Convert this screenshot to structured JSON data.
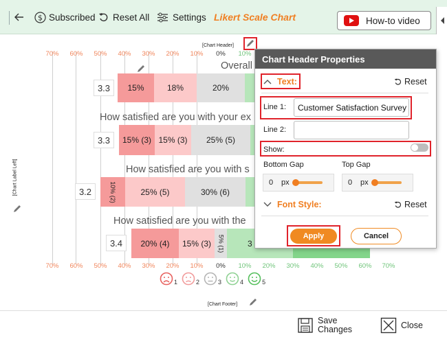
{
  "toolbar": {
    "subscribed": "Subscribed",
    "reset_all": "Reset All",
    "settings": "Settings",
    "title": "Likert Scale Chart",
    "howto": "How-to video"
  },
  "chart": {
    "chart_header": "[Chart Header]",
    "chart_footer": "[Chart Footer]",
    "chart_label_left": "[Chart Label Left]",
    "axis_labels": [
      "70%",
      "60%",
      "50%",
      "40%",
      "30%",
      "20%",
      "10%",
      "0%",
      "10%",
      "20%",
      "30%",
      "40%",
      "50%",
      "60%",
      "70%"
    ],
    "visible_top_axis": [
      "70%",
      "60%",
      "50%",
      "40%",
      "30%",
      "20%",
      "10%",
      "0%",
      "10%"
    ],
    "rows": [
      {
        "question": "Overall",
        "score": "3.3",
        "segments": [
          "15%",
          "18%",
          "20%"
        ]
      },
      {
        "question": "How satisfied are you with your ex",
        "score": "3.3",
        "segments": [
          "15% (3)",
          "15% (3)",
          "25% (5)"
        ]
      },
      {
        "question": "How satisfied are you with s",
        "score": "3.2",
        "segments": [
          "10% (2)",
          "25% (5)",
          "30% (6)"
        ]
      },
      {
        "question": "How satisfied are you with the",
        "score": "3.4",
        "segments": [
          "20% (4)",
          "15% (3)",
          "5% (1)",
          "3"
        ]
      }
    ],
    "faces": [
      "1",
      "2",
      "3",
      "4",
      "5"
    ],
    "colors": {
      "very_negative": "#f59a9a",
      "negative": "#fcc9c9",
      "neutral": "#e0e0e0",
      "positive": "#b7e6ba",
      "very_positive": "#83d58a"
    }
  },
  "popup": {
    "title": "Chart Header Properties",
    "text_section": "Text:",
    "reset": "Reset",
    "line1_label": "Line 1:",
    "line1_value": "Customer Satisfaction Survey",
    "line2_label": "Line 2:",
    "line2_value": "",
    "show_label": "Show:",
    "show_on": false,
    "bottom_gap_label": "Bottom Gap",
    "top_gap_label": "Top Gap",
    "bottom_gap_value": "0",
    "top_gap_value": "0",
    "unit": "px",
    "font_style": "Font Style:",
    "font_reset": "Reset",
    "apply": "Apply",
    "cancel": "Cancel"
  },
  "footer": {
    "save_line1": "Save",
    "save_line2": "Changes",
    "close": "Close"
  }
}
